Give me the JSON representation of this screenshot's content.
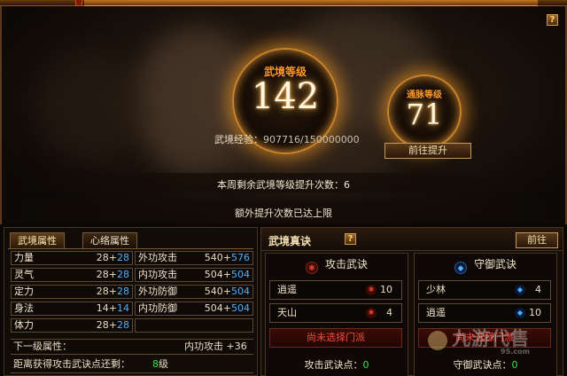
{
  "window": {
    "title": "武境",
    "help": "?"
  },
  "orb_main": {
    "label": "武境等级",
    "level": "142"
  },
  "orb_side": {
    "label": "通脉等级",
    "level": "71"
  },
  "exp": {
    "label": "武境经验：",
    "value": "907716/150000000"
  },
  "goto_upgrade": "前往提升",
  "weekly_text": "本周剩余武境等级提升次数：6",
  "extra_text": "额外提升次数已达上限",
  "tabs": [
    {
      "label": "武境属性"
    },
    {
      "label": "心络属性"
    }
  ],
  "stats": {
    "r0": {
      "l": {
        "label": "力量",
        "base": "28+",
        "bonus": "28"
      },
      "r": {
        "label": "外功攻击",
        "base": "540+",
        "bonus": "576"
      }
    },
    "r1": {
      "l": {
        "label": "灵气",
        "base": "28+",
        "bonus": "28"
      },
      "r": {
        "label": "内功攻击",
        "base": "504+",
        "bonus": "504"
      }
    },
    "r2": {
      "l": {
        "label": "定力",
        "base": "28+",
        "bonus": "28"
      },
      "r": {
        "label": "外功防御",
        "base": "540+",
        "bonus": "504"
      }
    },
    "r3": {
      "l": {
        "label": "身法",
        "base": "14+",
        "bonus": "14"
      },
      "r": {
        "label": "内功防御",
        "base": "504+",
        "bonus": "504"
      }
    },
    "r4": {
      "l": {
        "label": "体力",
        "base": "28+",
        "bonus": "28"
      }
    }
  },
  "next_level": {
    "label": "下一级属性：",
    "value": "内功攻击 +36"
  },
  "distance": {
    "label": "距离获得攻击武诀点还剩：",
    "value": "8",
    "unit": "级"
  },
  "secret": {
    "title": "武境真诀",
    "help": "?",
    "goto": "前往"
  },
  "attack": {
    "title": "攻击武诀",
    "skills": [
      {
        "name": "逍遥",
        "count": "10"
      },
      {
        "name": "天山",
        "count": "4"
      }
    ],
    "unchosen": "尚未选择门派",
    "points_label": "攻击武诀点：",
    "points": "0"
  },
  "defense": {
    "title": "守御武诀",
    "skills": [
      {
        "name": "少林",
        "count": "4"
      },
      {
        "name": "逍遥",
        "count": "10"
      }
    ],
    "unchosen": "尚未选择门派",
    "points_label": "守御武诀点：",
    "points": "0"
  },
  "watermark": {
    "text": "九游代售",
    "sub": "9S.com"
  },
  "colors": {
    "accent": "#ff9a2a",
    "bonus_blue": "#4ab0ff",
    "green": "#3ae04a",
    "red": "#ff4a3a"
  }
}
